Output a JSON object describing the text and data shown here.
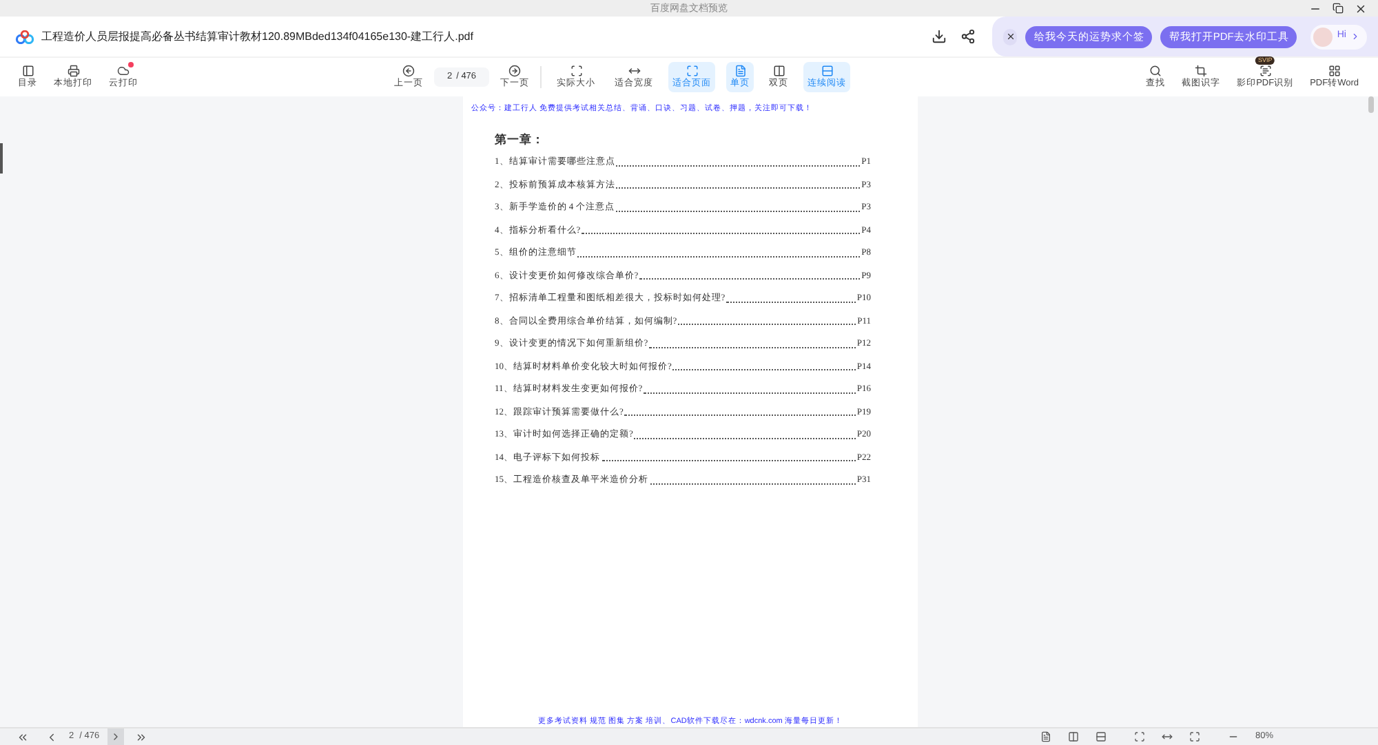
{
  "window": {
    "title": "百度网盘文档预览"
  },
  "file": {
    "name": "工程造价人员层报提高必备丛书结算审计教材120.89MBded134f04165e130-建工行人.pdf"
  },
  "assistant": {
    "suggestions": [
      "给我今天的运势求个签",
      "帮我打开PDF去水印工具"
    ],
    "greeting": "Hi"
  },
  "toolbar_left": [
    {
      "kind": "outline",
      "label": "目录",
      "badge": false
    },
    {
      "kind": "print",
      "label": "本地打印",
      "badge": false
    },
    {
      "kind": "cloud-print",
      "label": "云打印",
      "badge": true
    }
  ],
  "navigation": {
    "prev": "上一页",
    "page": "2",
    "total": "/ 476",
    "next": "下一页"
  },
  "view_buttons": [
    {
      "kind": "actual",
      "label": "实际大小",
      "selected": false
    },
    {
      "kind": "fit-width",
      "label": "适合宽度",
      "selected": false
    },
    {
      "kind": "fit-page",
      "label": "适合页面",
      "selected": true
    },
    {
      "kind": "single",
      "label": "单页",
      "selected": true
    },
    {
      "kind": "double",
      "label": "双页",
      "selected": false
    },
    {
      "kind": "continuous",
      "label": "连续阅读",
      "selected": true
    }
  ],
  "toolbar_right": [
    {
      "kind": "search",
      "label": "查找"
    },
    {
      "kind": "crop",
      "label": "截图识字"
    },
    {
      "kind": "ocr",
      "label": "影印PDF识别",
      "badge": "SVIP"
    },
    {
      "kind": "convert",
      "label": "PDF转Word"
    }
  ],
  "page": {
    "header": "公众号：建工行人 免费提供考试相关总结、背诵、口诀、习题、试卷、押题，关注即可下载！",
    "chapter": "第一章：",
    "toc": [
      {
        "title": "1、结算审计需要哪些注意点",
        "page": "P1"
      },
      {
        "title": "2、投标前预算成本核算方法",
        "page": "P3"
      },
      {
        "title": "3、新手学造价的 4 个注意点",
        "page": "P3"
      },
      {
        "title": "4、指标分析看什么?",
        "page": "P4"
      },
      {
        "title": "5、组价的注意细节",
        "page": "P8"
      },
      {
        "title": "6、设计变更价如何修改综合单价?",
        "page": "P9"
      },
      {
        "title": "7、招标清单工程量和图纸相差很大，投标时如何处理?",
        "page": "P10"
      },
      {
        "title": "8、合同以全费用综合单价结算，如何编制?",
        "page": "P11"
      },
      {
        "title": "9、设计变更的情况下如何重新组价?",
        "page": "P12"
      },
      {
        "title": "10、结算时材料单价变化较大时如何报价?",
        "page": "P14"
      },
      {
        "title": "11、结算时材料发生变更如何报价?",
        "page": "P16"
      },
      {
        "title": "12、跟踪审计预算需要做什么?",
        "page": "P19"
      },
      {
        "title": "13、审计时如何选择正确的定额?",
        "page": "P20"
      },
      {
        "title": "14、电子评标下如何投标",
        "page": "P22"
      },
      {
        "title": "15、工程造价核查及单平米造价分析",
        "page": "P31"
      }
    ],
    "footer": "更多考试资料 规范 图集 方案 培训、CAD软件下载尽在：wdcnk.com 海量每日更新！"
  },
  "status_bar": {
    "page": "2",
    "total": "/ 476",
    "zoom": "80%"
  }
}
